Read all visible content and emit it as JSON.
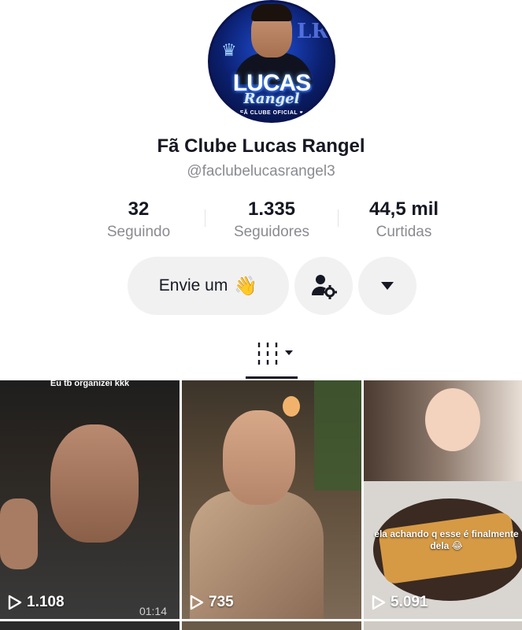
{
  "profile": {
    "avatar_text_line1": "LUCAS",
    "avatar_text_line2": "Rangel",
    "avatar_text_line3": "FÃ CLUBE OFICIAL ♥",
    "avatar_monogram": "LR",
    "name": "Fã Clube Lucas Rangel",
    "handle": "@faclubelucasrangel3"
  },
  "stats": [
    {
      "value": "32",
      "label": "Seguindo"
    },
    {
      "value": "1.335",
      "label": "Seguidores"
    },
    {
      "value": "44,5 mil",
      "label": "Curtidas"
    }
  ],
  "actions": {
    "message_label": "Envie um",
    "message_emoji": "👋"
  },
  "videos": [
    {
      "views": "1.108",
      "caption": "Eu tb organizei  kkk",
      "duration": "01:14"
    },
    {
      "views": "735"
    },
    {
      "views": "5.091",
      "caption": "ela achando q esse é finalmente dela 😂"
    }
  ],
  "icons": {
    "play": "play-icon",
    "friends": "add-friend-settings-icon",
    "more": "chevron-down-icon",
    "tab": "grid-videos-icon"
  },
  "colors": {
    "text_primary": "#161823",
    "text_secondary": "#8a8b91",
    "button_bg": "#f1f1f2"
  }
}
